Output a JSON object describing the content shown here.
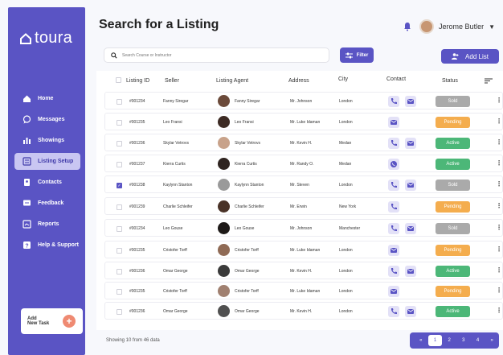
{
  "brand": {
    "name": "toura"
  },
  "header": {
    "title": "Search for a Listing",
    "user_name": "Jerome Butler"
  },
  "toolbar": {
    "search_placeholder": "Search Course or Instructor",
    "filter_label": "Filter",
    "add_label": "Add List"
  },
  "sidebar": {
    "items": [
      {
        "label": "Home",
        "icon": "home-icon",
        "active": false
      },
      {
        "label": "Messages",
        "icon": "chat-icon",
        "active": false
      },
      {
        "label": "Showings",
        "icon": "bar-chart-icon",
        "active": false
      },
      {
        "label": "Listing Setup",
        "icon": "list-icon",
        "active": true
      },
      {
        "label": "Contacts",
        "icon": "contacts-icon",
        "active": false
      },
      {
        "label": "Feedback",
        "icon": "feedback-icon",
        "active": false
      },
      {
        "label": "Reports",
        "icon": "report-icon",
        "active": false
      },
      {
        "label": "Help & Support",
        "icon": "help-icon",
        "active": false
      }
    ],
    "add_task": {
      "line1": "Add",
      "line2": "New Task"
    }
  },
  "table": {
    "headers": {
      "id": "Listing ID",
      "seller": "Seller",
      "agent": "Listing Agent",
      "address": "Address",
      "city": "City",
      "contact": "Contact",
      "status": "Status"
    },
    "rows": [
      {
        "id": "#001234",
        "seller": "Fanny Siregar",
        "agent": "Fanny Siregar",
        "address": "Mr. Johnson",
        "city": "London",
        "contact": [
          "phone",
          "mail"
        ],
        "status": "Sold",
        "checked": false
      },
      {
        "id": "#001235",
        "seller": "Leo Fransi",
        "agent": "Leo Fransi",
        "address": "Mr. Luke Idaman",
        "city": "London",
        "contact": [
          "mail"
        ],
        "status": "Pending",
        "checked": false
      },
      {
        "id": "#001236",
        "seller": "Skylar Vetrovs",
        "agent": "Skylar Vetrovs",
        "address": "Mr. Kevin H.",
        "city": "Medan",
        "contact": [
          "phone",
          "mail"
        ],
        "status": "Active",
        "checked": false
      },
      {
        "id": "#001237",
        "seller": "Kierra Curtis",
        "agent": "Kierra Curtis",
        "address": "Mr. Randy O.",
        "city": "Medan",
        "contact": [
          "whatsapp"
        ],
        "status": "Active",
        "checked": false
      },
      {
        "id": "#001238",
        "seller": "Kaylynn Stanton",
        "agent": "Kaylynn Stanton",
        "address": "Mr. Steven",
        "city": "London",
        "contact": [
          "phone",
          "mail"
        ],
        "status": "Sold",
        "checked": true
      },
      {
        "id": "#001239",
        "seller": "Charlie Schleifer",
        "agent": "Charlie Schleifer",
        "address": "Mr. Erwin",
        "city": "New York",
        "contact": [
          "phone"
        ],
        "status": "Pending",
        "checked": false
      },
      {
        "id": "#001234",
        "seller": "Leo Gouse",
        "agent": "Leo Gouse",
        "address": "Mr. Johnson",
        "city": "Manchester",
        "contact": [
          "phone",
          "mail"
        ],
        "status": "Sold",
        "checked": false
      },
      {
        "id": "#001235",
        "seller": "Cristofer Torff",
        "agent": "Cristofer Torff",
        "address": "Mr. Luke Idaman",
        "city": "London",
        "contact": [
          "mail"
        ],
        "status": "Pending",
        "checked": false
      },
      {
        "id": "#001236",
        "seller": "Omar George",
        "agent": "Omar George",
        "address": "Mr. Kevin H.",
        "city": "London",
        "contact": [
          "phone",
          "mail"
        ],
        "status": "Active",
        "checked": false
      },
      {
        "id": "#001235",
        "seller": "Cristofer Torff",
        "agent": "Cristofer Torff",
        "address": "Mr. Luke Idaman",
        "city": "London",
        "contact": [
          "mail"
        ],
        "status": "Pending",
        "checked": false
      },
      {
        "id": "#001236",
        "seller": "Omar George",
        "agent": "Omar George",
        "address": "Mr. Kevin H.",
        "city": "London",
        "contact": [
          "phone",
          "mail"
        ],
        "status": "Active",
        "checked": false
      }
    ]
  },
  "footer": {
    "showing": "Showing 10 from 46 data"
  },
  "pagination": {
    "prev": "«",
    "pages": [
      "1",
      "2",
      "3",
      "4"
    ],
    "active": "1",
    "next": "»"
  },
  "colors": {
    "primary": "#5a54c4",
    "sold": "#aaaaaa",
    "pending": "#f4ad4e",
    "active": "#4cb778"
  }
}
